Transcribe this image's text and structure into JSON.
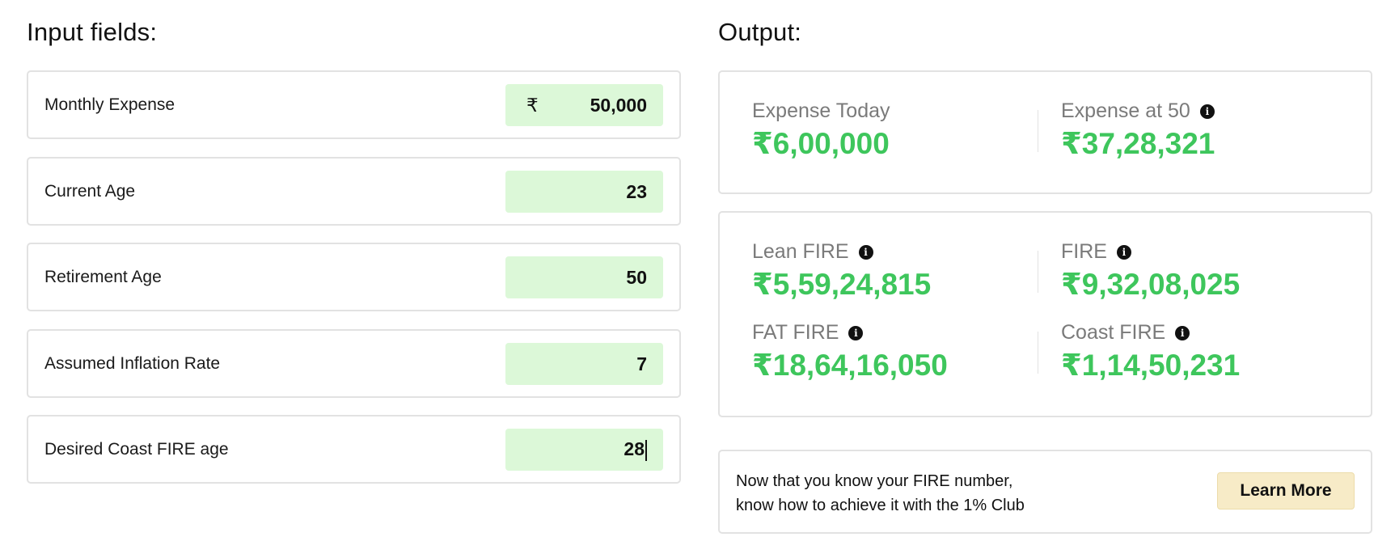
{
  "input": {
    "heading": "Input fields:",
    "fields": [
      {
        "label": "Monthly Expense",
        "prefix": "₹",
        "value": "50,000"
      },
      {
        "label": "Current Age",
        "value": "23"
      },
      {
        "label": "Retirement Age",
        "value": "50"
      },
      {
        "label": "Assumed Inflation Rate",
        "value": "7"
      },
      {
        "label": "Desired Coast FIRE age",
        "value": "28"
      }
    ]
  },
  "output": {
    "heading": "Output:",
    "expense_today": {
      "label": "Expense Today",
      "value": "₹6,00,000"
    },
    "expense_at": {
      "label": "Expense at 50",
      "value": "₹37,28,321"
    },
    "lean_fire": {
      "label": "Lean FIRE",
      "value": "₹5,59,24,815"
    },
    "fire": {
      "label": "FIRE",
      "value": "₹9,32,08,025"
    },
    "fat_fire": {
      "label": "FAT FIRE",
      "value": "₹18,64,16,050"
    },
    "coast_fire": {
      "label": "Coast FIRE",
      "value": "₹1,14,50,231"
    }
  },
  "cta": {
    "line1": "Now that you know your FIRE number,",
    "line2": "know how to achieve it with the 1% Club",
    "button": "Learn More"
  },
  "icons": {
    "info": "info-icon"
  },
  "colors": {
    "accent_green": "#3ec65c",
    "input_bg": "#dcf8d8",
    "button_bg": "#f7ebc7"
  }
}
